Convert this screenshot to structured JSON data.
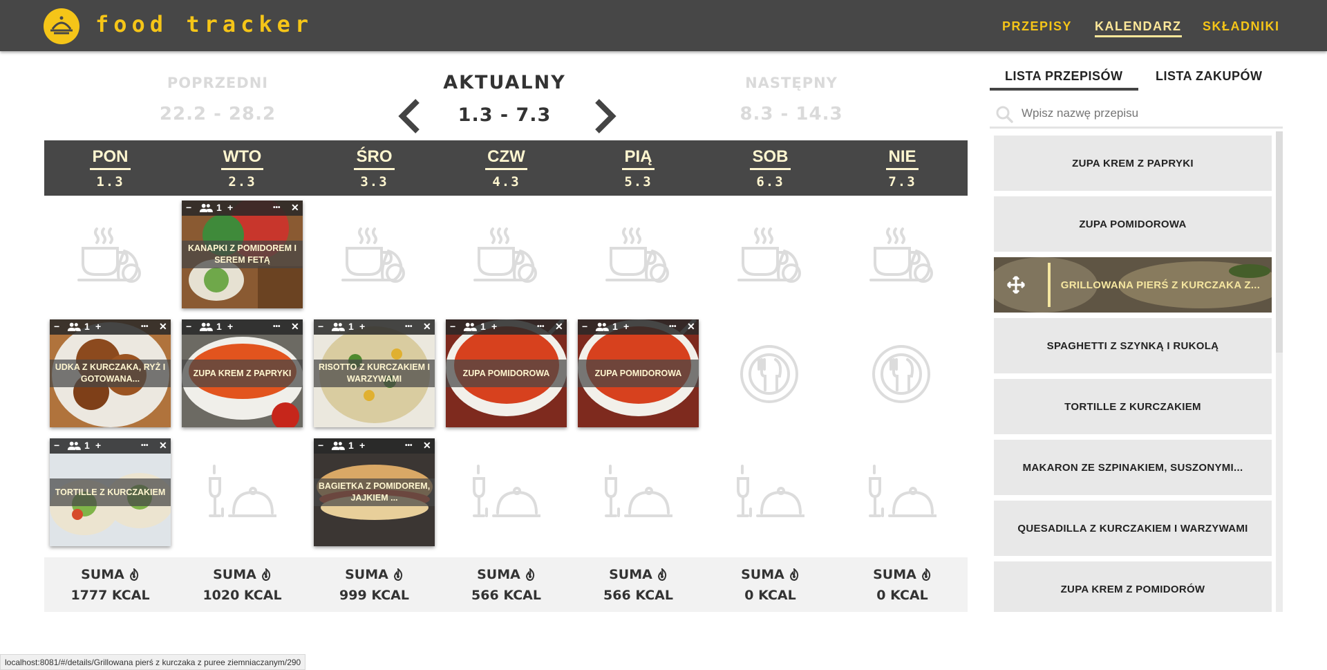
{
  "app": {
    "title": "food tracker",
    "accent": "#f5c518",
    "header_bg": "#474747"
  },
  "nav": {
    "recipes": "PRZEPISY",
    "calendar": "KALENDARZ",
    "ingredients": "SKŁADNIKI",
    "active": "KALENDARZ"
  },
  "weeks": {
    "prev": {
      "title": "POPRZEDNI",
      "range": "22.2 - 28.2"
    },
    "current": {
      "title": "AKTUALNY",
      "range": "1.3 - 7.3"
    },
    "next": {
      "title": "NASTĘPNY",
      "range": "8.3 - 14.3"
    }
  },
  "days": [
    {
      "name": "PON",
      "date": "1.3"
    },
    {
      "name": "WTO",
      "date": "2.3"
    },
    {
      "name": "ŚRO",
      "date": "3.3"
    },
    {
      "name": "CZW",
      "date": "4.3"
    },
    {
      "name": "PIĄ",
      "date": "5.3"
    },
    {
      "name": "SOB",
      "date": "6.3"
    },
    {
      "name": "NIE",
      "date": "7.3"
    }
  ],
  "meals": {
    "breakfast": [
      null,
      {
        "name": "KANAPKI Z POMIDOREM I SEREM FETĄ",
        "servings": "1",
        "image": "sandwich-tomato-feta"
      },
      null,
      null,
      null,
      null,
      null
    ],
    "lunch": [
      {
        "name": "UDKA Z KURCZAKA, RYŻ I GOTOWANA...",
        "servings": "1",
        "image": "chicken-drumsticks"
      },
      {
        "name": "ZUPA KREM Z PAPRYKI",
        "servings": "1",
        "image": "pepper-cream-soup"
      },
      {
        "name": "RISOTTO Z KURCZAKIEM I WARZYWAMI",
        "servings": "1",
        "image": "risotto"
      },
      {
        "name": "ZUPA POMIDOROWA",
        "servings": "1",
        "image": "tomato-soup"
      },
      {
        "name": "ZUPA POMIDOROWA",
        "servings": "1",
        "image": "tomato-soup"
      },
      null,
      null
    ],
    "dinner": [
      {
        "name": "TORTILLE Z KURCZAKIEM",
        "servings": "1",
        "image": "tortilla-wraps"
      },
      null,
      {
        "name": "BAGIETKA Z POMIDOREM, JAJKIEM ...",
        "servings": "1",
        "image": "baguette"
      },
      null,
      null,
      null,
      null
    ]
  },
  "card_controls": {
    "minus": "−",
    "plus": "+",
    "more": "•••",
    "close": "✕",
    "people_icon": "people-icon"
  },
  "sums": [
    {
      "label": "SUMA",
      "value": "1777 KCAL"
    },
    {
      "label": "SUMA",
      "value": "1020 KCAL"
    },
    {
      "label": "SUMA",
      "value": "999 KCAL"
    },
    {
      "label": "SUMA",
      "value": "566 KCAL"
    },
    {
      "label": "SUMA",
      "value": "566 KCAL"
    },
    {
      "label": "SUMA",
      "value": "0 KCAL"
    },
    {
      "label": "SUMA",
      "value": "0 KCAL"
    }
  ],
  "sidebar": {
    "tabs": {
      "recipes": "LISTA PRZEPISÓW",
      "shopping": "LISTA ZAKUPÓW"
    },
    "search_placeholder": "Wpisz nazwę przepisu",
    "recipes": [
      "ZUPA KREM Z PAPRYKI",
      "ZUPA POMIDOROWA",
      "GRILLOWANA PIERŚ Z KURCZAKA Z...",
      "SPAGHETTI Z SZYNKĄ I RUKOLĄ",
      "TORTILLE Z KURCZAKIEM",
      "MAKARON ZE SZPINAKIEM, SUSZONYMI...",
      "QUESADILLA Z KURCZAKIEM I WARZYWAMI",
      "ZUPA KREM Z POMIDORÓW"
    ]
  },
  "status_url": "localhost:8081/#/details/Grillowana pierś z kurczaka z puree ziemniaczanym/290"
}
